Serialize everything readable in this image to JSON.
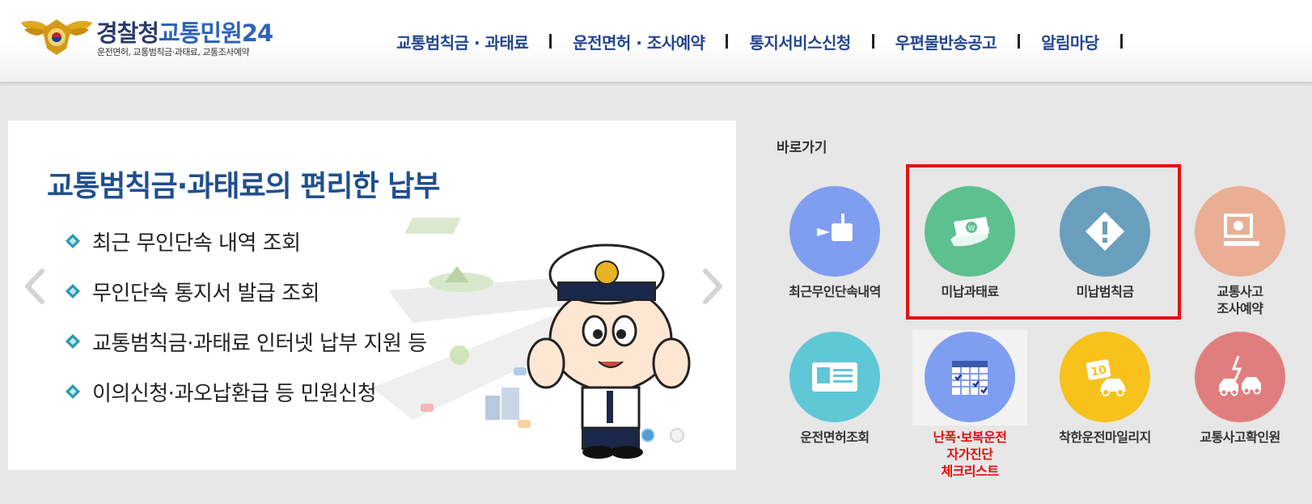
{
  "header": {
    "logo_title_1": "경찰청",
    "logo_title_2": "교통민원24",
    "logo_subtitle": "운전면허, 교통범칙금·과태료, 교통조사예약",
    "nav": [
      {
        "label": "교통범칙금 · 과태료"
      },
      {
        "label": "운전면허 · 조사예약"
      },
      {
        "label": "통지서비스신청"
      },
      {
        "label": "우편물반송공고"
      },
      {
        "label": "알림마당"
      }
    ]
  },
  "banner": {
    "title": "교통범칙금·과태료의 편리한 납부",
    "items": [
      {
        "text": "최근 무인단속 내역 조회"
      },
      {
        "text": "무인단속 통지서 발급 조회"
      },
      {
        "text": "교통범칙금·과태료 인터넷 납부 지원 등"
      },
      {
        "text": "이의신청·과오납환급 등 민원신청"
      }
    ],
    "slide_count": 2,
    "active_slide": 1
  },
  "quick": {
    "title": "바로가기",
    "items": [
      {
        "label": "최근무인단속내역",
        "color": "#7f9ef0",
        "icon": "camera-icon"
      },
      {
        "label": "미납과태료",
        "color": "#5cc08f",
        "icon": "money-icon"
      },
      {
        "label": "미납범칙금",
        "color": "#6a9fbe",
        "icon": "warning-icon"
      },
      {
        "label_1": "교통사고",
        "label_2": "조사예약",
        "color": "#e9ae94",
        "icon": "computer-icon"
      },
      {
        "label": "운전면허조회",
        "color": "#5fc7d6",
        "icon": "id-card-icon"
      },
      {
        "label_1": "난폭·보복운전",
        "label_2": "자가진단",
        "label_3": "체크리스트",
        "color": "#7f9ef0",
        "icon": "checklist-icon"
      },
      {
        "label": "착한운전마일리지",
        "color": "#f7c21c",
        "icon": "mileage-car-icon"
      },
      {
        "label": "교통사고확인원",
        "color": "#e07e7e",
        "icon": "car-crash-icon"
      }
    ],
    "highlight_color": "#e81010"
  }
}
